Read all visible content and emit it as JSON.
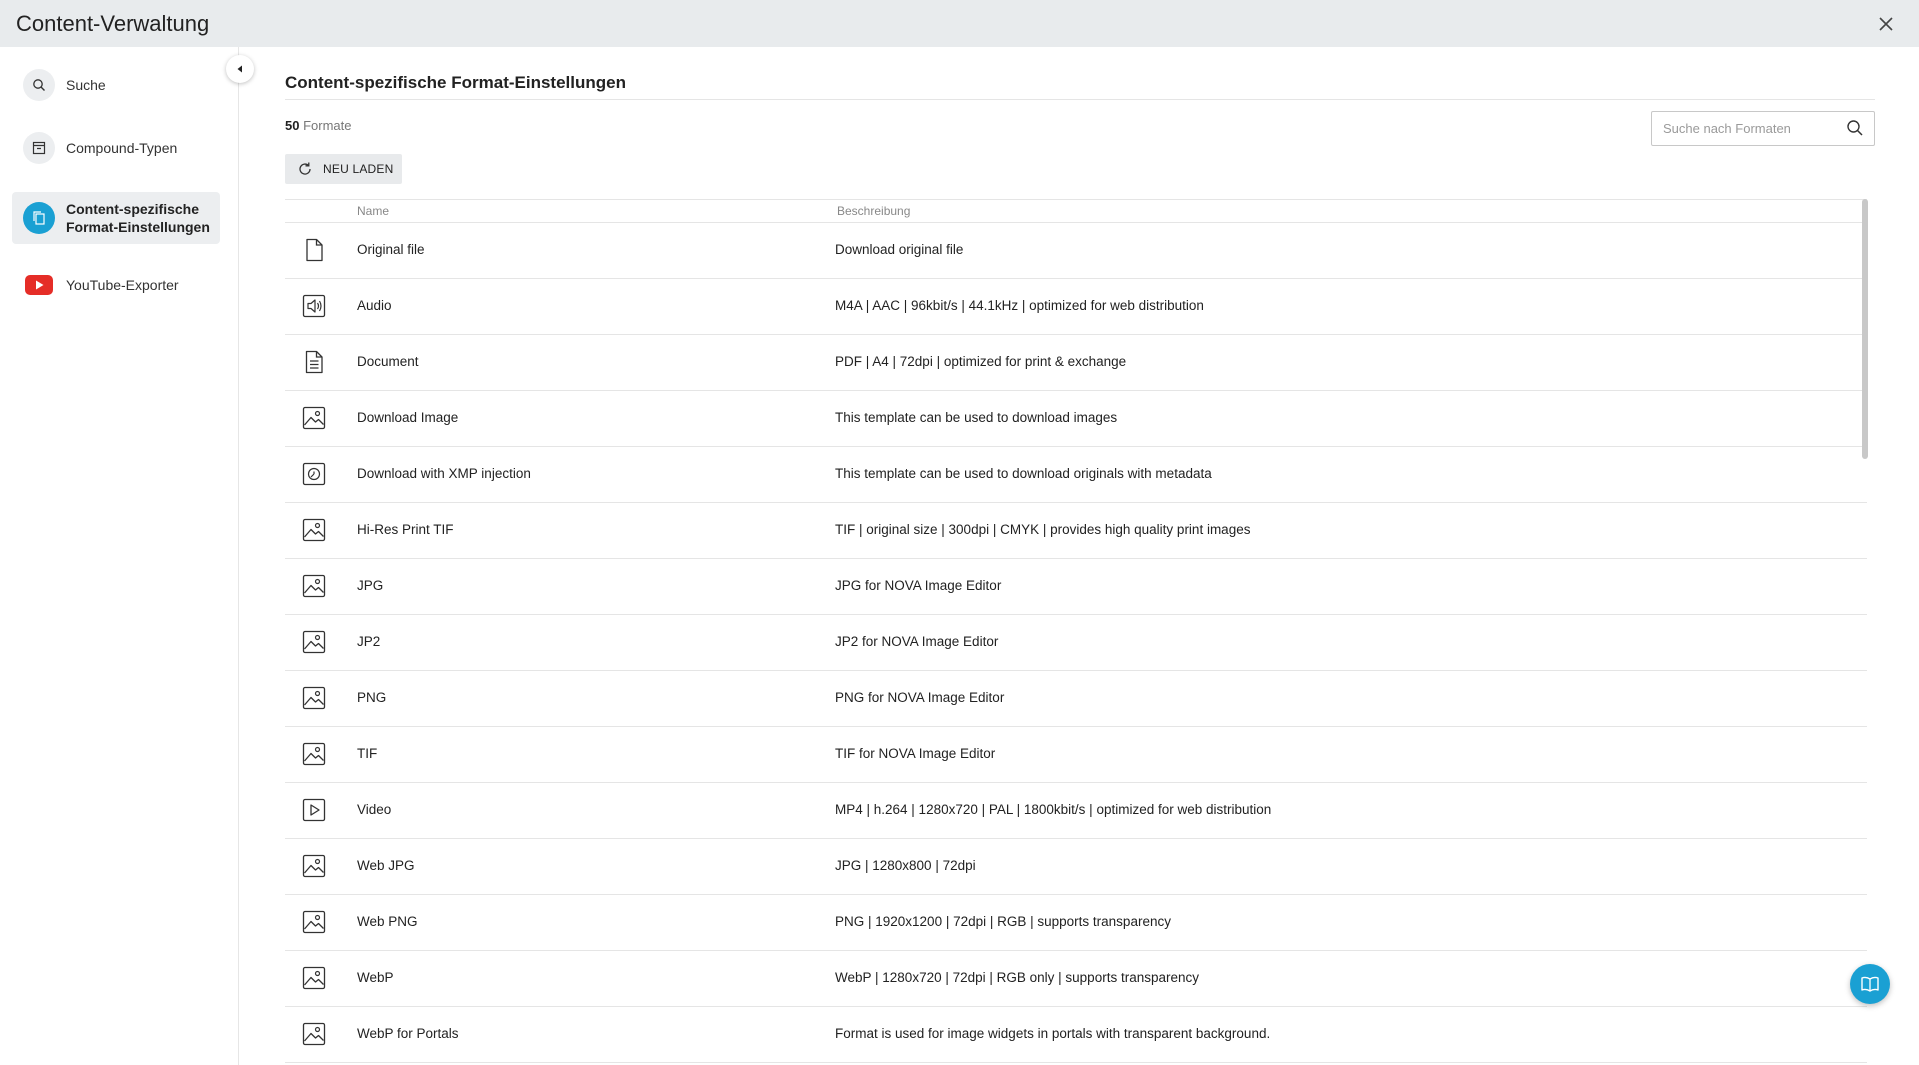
{
  "window": {
    "title": "Content-Verwaltung",
    "close_icon": "close-icon"
  },
  "sidebar": {
    "collapse_icon": "caret-left-icon",
    "items": [
      {
        "label": "Suche",
        "icon": "search-icon",
        "active": false
      },
      {
        "label": "Compound-Typen",
        "icon": "archive-box-icon",
        "active": false
      },
      {
        "label": "Content-spezifische Format-Einstellungen",
        "icon": "copy-pages-icon",
        "active": true
      },
      {
        "label": "YouTube-Exporter",
        "icon": "youtube-icon",
        "active": false
      }
    ]
  },
  "main": {
    "title": "Content-spezifische Format-Einstellungen",
    "count_value": "50",
    "count_label": "Formate",
    "search_placeholder": "Suche nach Formaten",
    "reload_label": "NEU LADEN",
    "columns": {
      "name": "Name",
      "description": "Beschreibung"
    },
    "rows": [
      {
        "icon": "file-icon",
        "name": "Original file",
        "description": "Download original file"
      },
      {
        "icon": "audio-icon",
        "name": "Audio",
        "description": "M4A | AAC | 96kbit/s | 44.1kHz | optimized for web distribution"
      },
      {
        "icon": "document-icon",
        "name": "Document",
        "description": "PDF | A4 | 72dpi | optimized for print & exchange"
      },
      {
        "icon": "image-icon",
        "name": "Download Image",
        "description": "This template can be used to download images"
      },
      {
        "icon": "xmp-icon",
        "name": "Download with XMP injection",
        "description": "This template can be used to download originals with metadata"
      },
      {
        "icon": "image-icon",
        "name": "Hi-Res Print TIF",
        "description": "TIF | original size | 300dpi | CMYK | provides high quality print images"
      },
      {
        "icon": "image-icon",
        "name": "JPG",
        "description": "JPG for NOVA Image Editor"
      },
      {
        "icon": "image-icon",
        "name": "JP2",
        "description": "JP2 for NOVA Image Editor"
      },
      {
        "icon": "image-icon",
        "name": "PNG",
        "description": "PNG for NOVA Image Editor"
      },
      {
        "icon": "image-icon",
        "name": "TIF",
        "description": "TIF for NOVA Image Editor"
      },
      {
        "icon": "video-icon",
        "name": "Video",
        "description": "MP4 | h.264 | 1280x720 | PAL | 1800kbit/s | optimized for web distribution"
      },
      {
        "icon": "image-icon",
        "name": "Web JPG",
        "description": "JPG | 1280x800 | 72dpi"
      },
      {
        "icon": "image-icon",
        "name": "Web PNG",
        "description": "PNG | 1920x1200 | 72dpi | RGB | supports transparency"
      },
      {
        "icon": "image-icon",
        "name": "WebP",
        "description": "WebP | 1280x720 | 72dpi | RGB only | supports transparency"
      },
      {
        "icon": "image-icon",
        "name": "WebP for Portals",
        "description": "Format is used for image widgets in portals with transparent background."
      }
    ]
  },
  "help_button": {
    "icon": "help-book-icon"
  },
  "colors": {
    "accent": "#1aa0d3",
    "youtube": "#e52d27",
    "active_bg": "#eceef0"
  }
}
